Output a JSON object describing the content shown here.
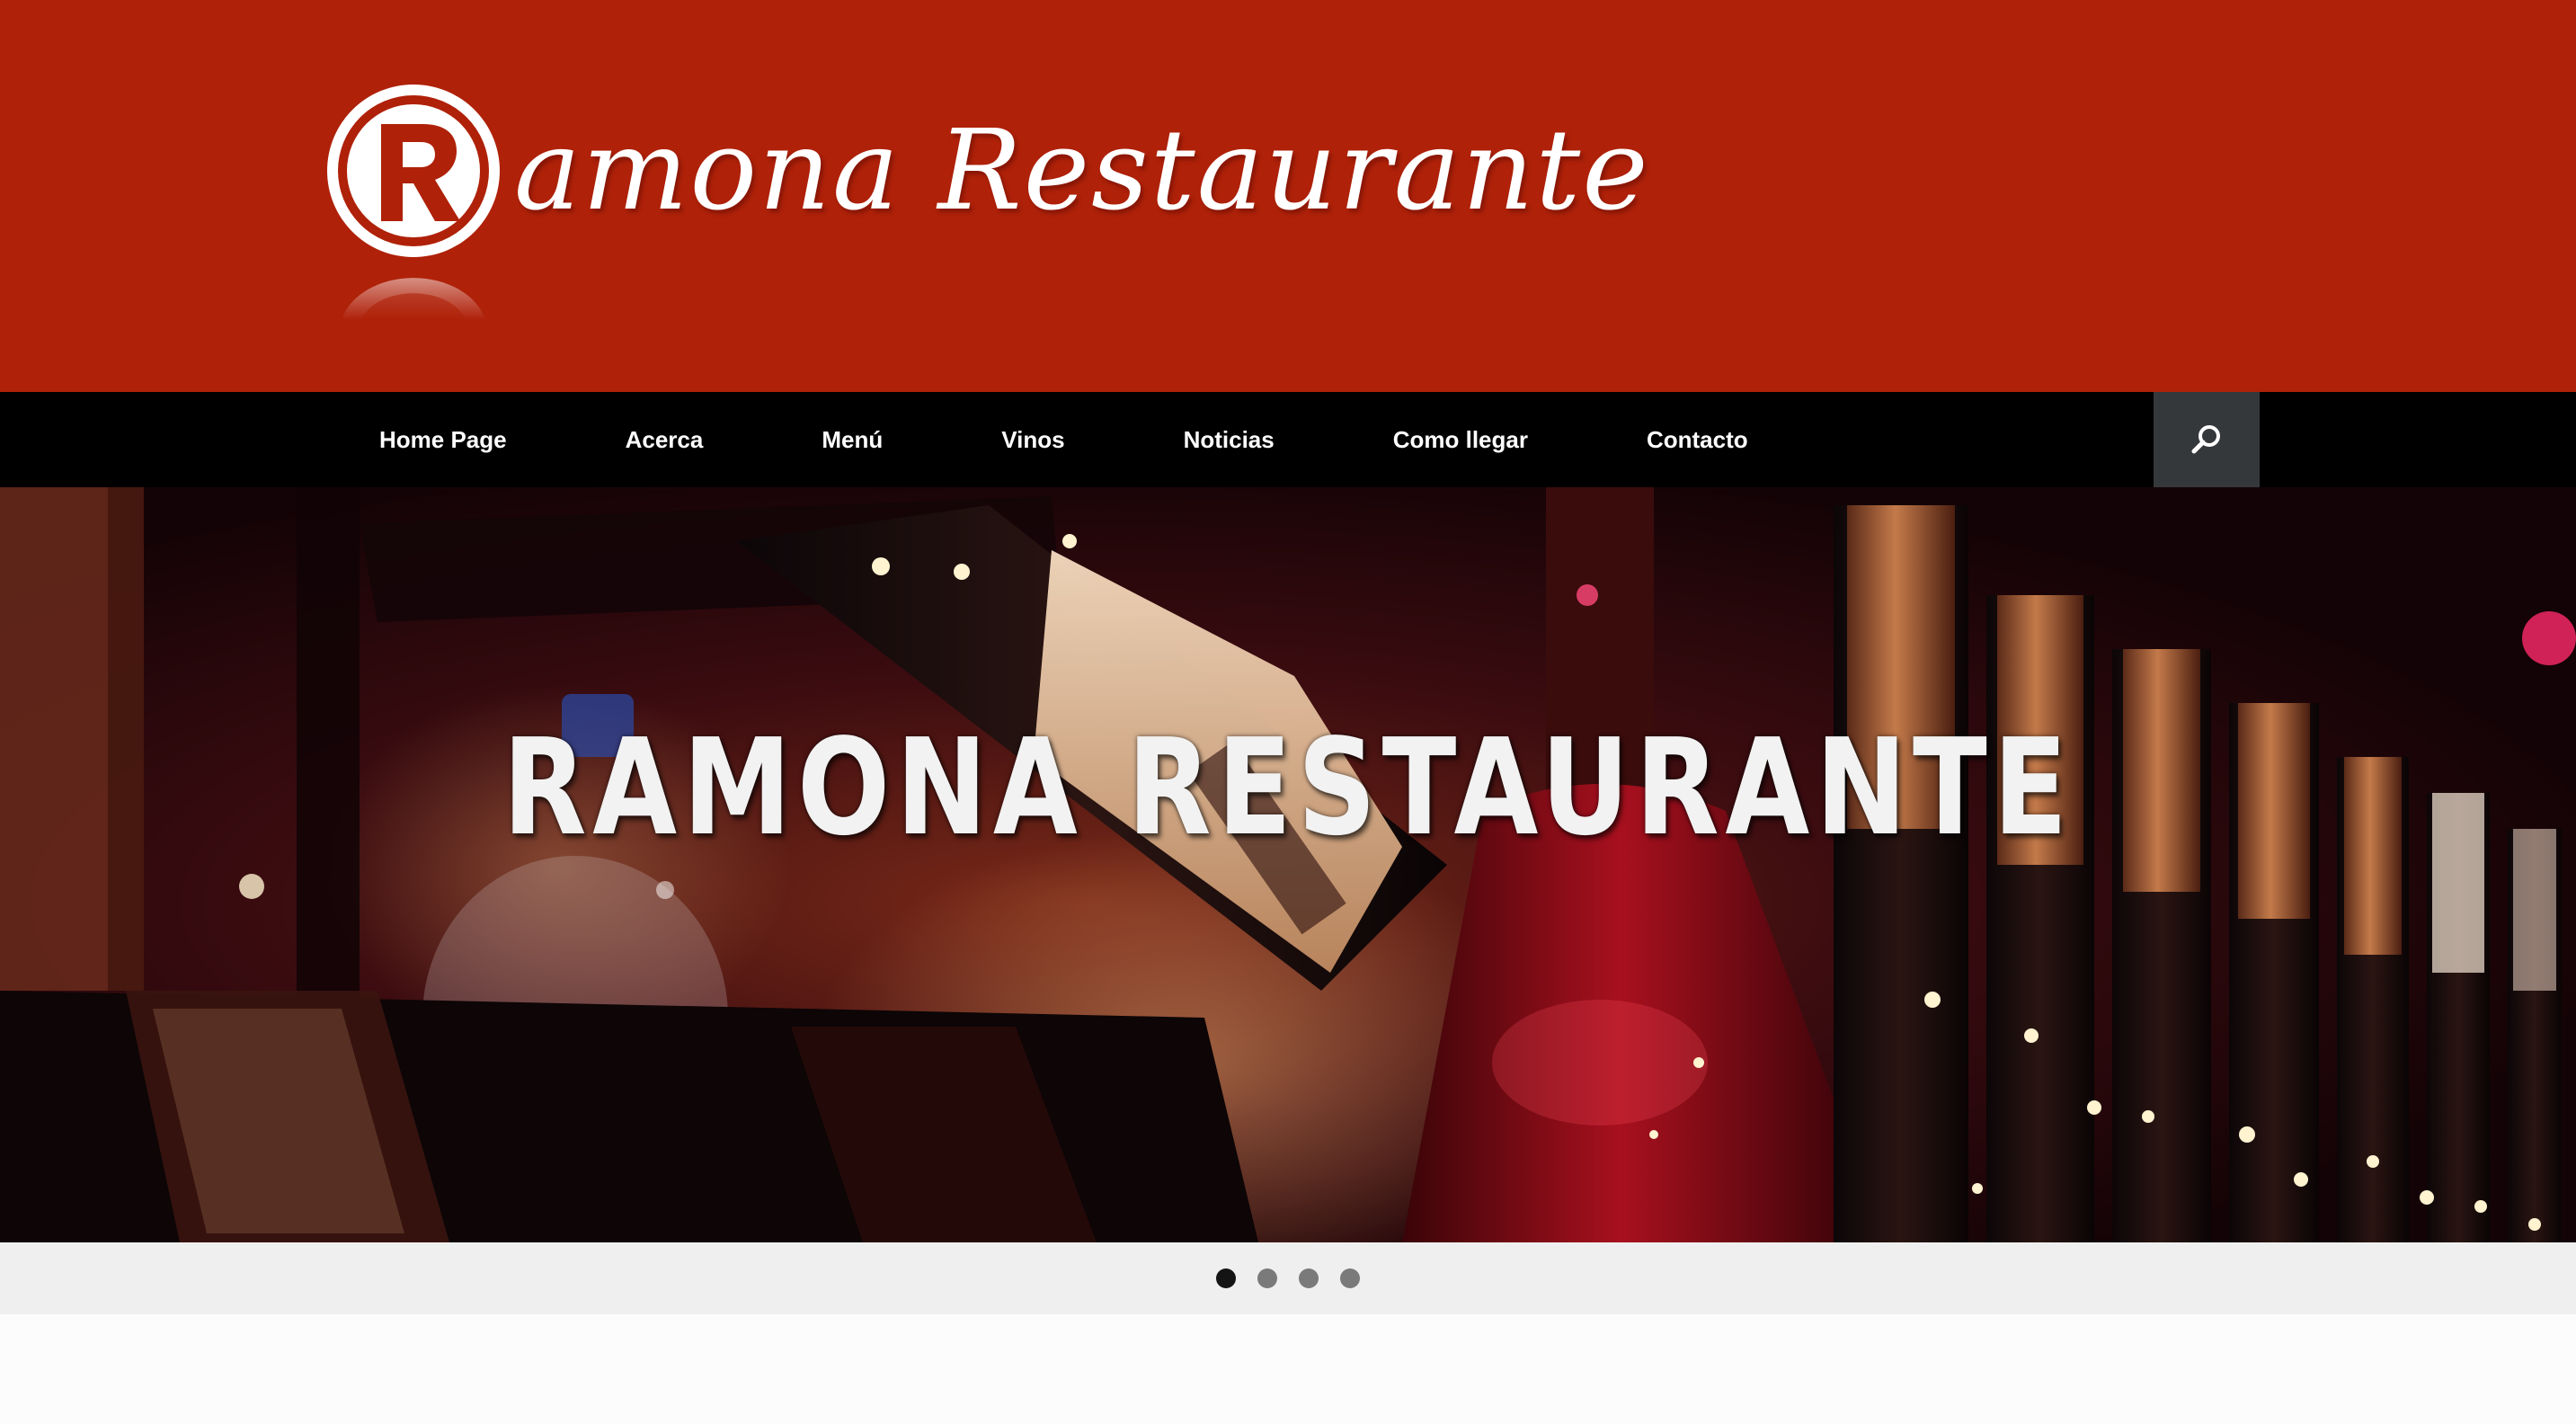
{
  "header": {
    "logo_letter": "R",
    "logo_text": "amona Restaurante",
    "background_color": "#af2109"
  },
  "nav": {
    "items": [
      {
        "label": "Home Page"
      },
      {
        "label": "Acerca"
      },
      {
        "label": "Menú"
      },
      {
        "label": "Vinos"
      },
      {
        "label": "Noticias"
      },
      {
        "label": "Como llegar"
      },
      {
        "label": "Contacto"
      }
    ],
    "search_icon": "search-icon"
  },
  "slider": {
    "title": "RAMONA RESTAURANTE",
    "slide_count": 4,
    "active_slide": 1
  }
}
